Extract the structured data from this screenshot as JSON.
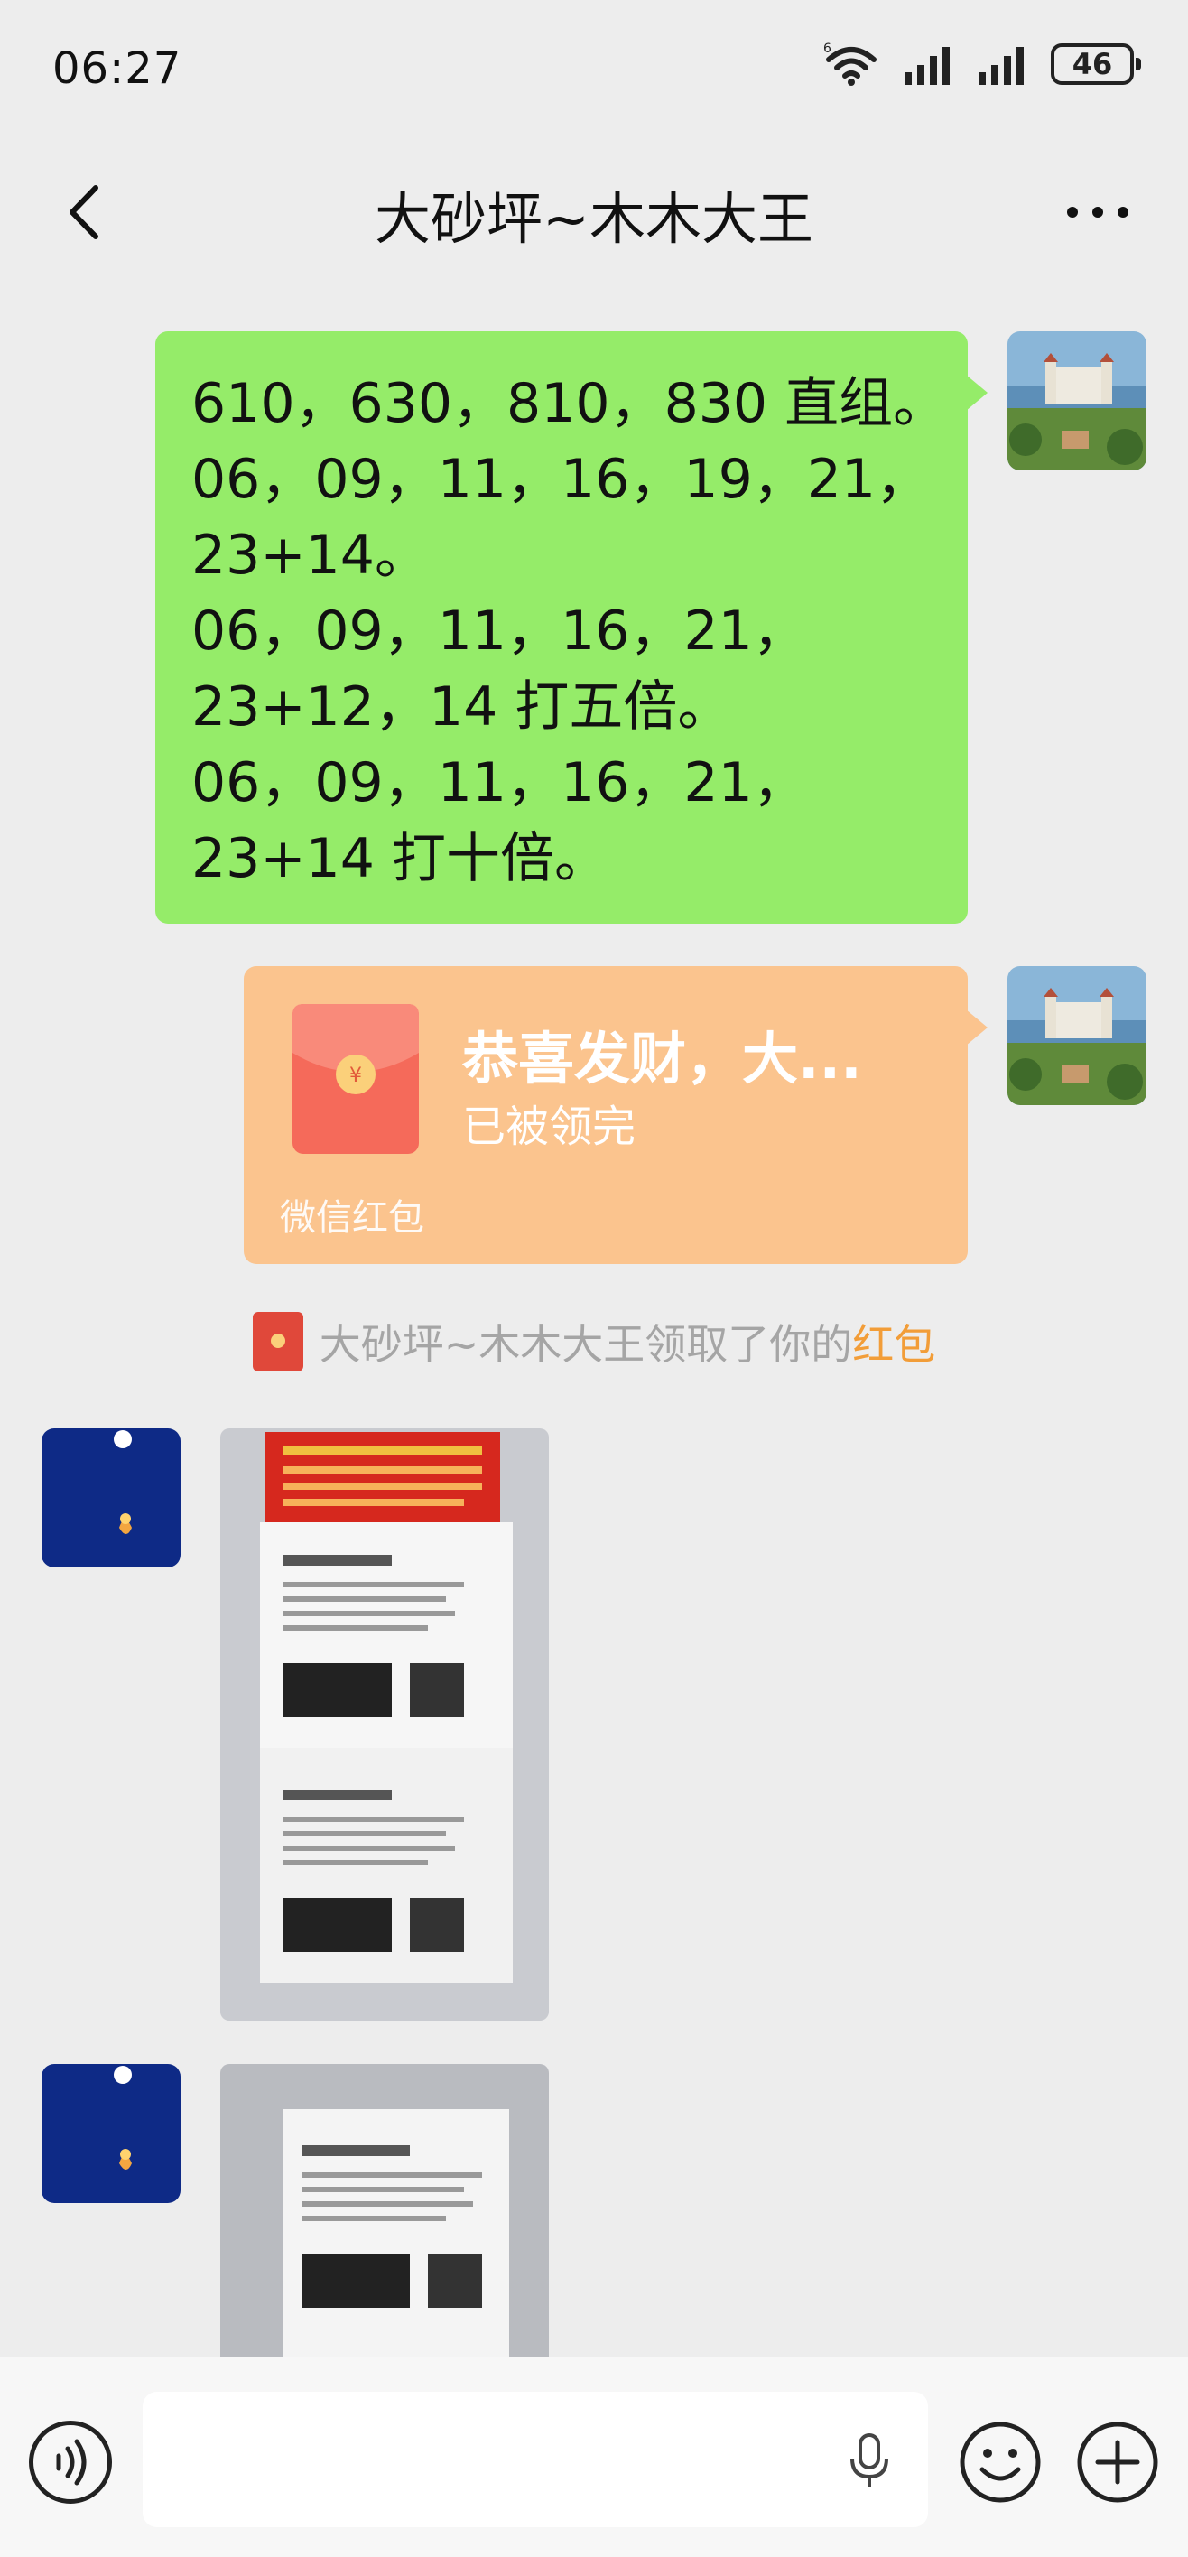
{
  "status_bar": {
    "time": "06:27",
    "network_label": "6",
    "battery": "46"
  },
  "header": {
    "title": "大砂坪~木木大王"
  },
  "messages": {
    "text_lines": [
      "610，630，810，830 直组。",
      "06，09，11，16，19，21，",
      "23+14。",
      "06，09，11，16，21，",
      "23+12，14 打五倍。",
      "06，09，11，16，21，",
      "23+14 打十倍。"
    ],
    "red_packet": {
      "title": "恭喜发财，大...",
      "status": "已被领完",
      "footer": "微信红包"
    },
    "system_notice": {
      "text": "大砂坪~木木大王领取了你的",
      "link": "红包"
    }
  },
  "colors": {
    "chat_bg": "#ededed",
    "sent_bubble": "#95ec69",
    "red_packet_bg": "#fbc48e",
    "link": "#f29d38"
  },
  "icons": {
    "back": "chevron-left-icon",
    "more": "more-dots-icon",
    "voice": "voice-icon",
    "mic": "microphone-icon",
    "emoji": "emoji-icon",
    "plus": "plus-icon"
  }
}
